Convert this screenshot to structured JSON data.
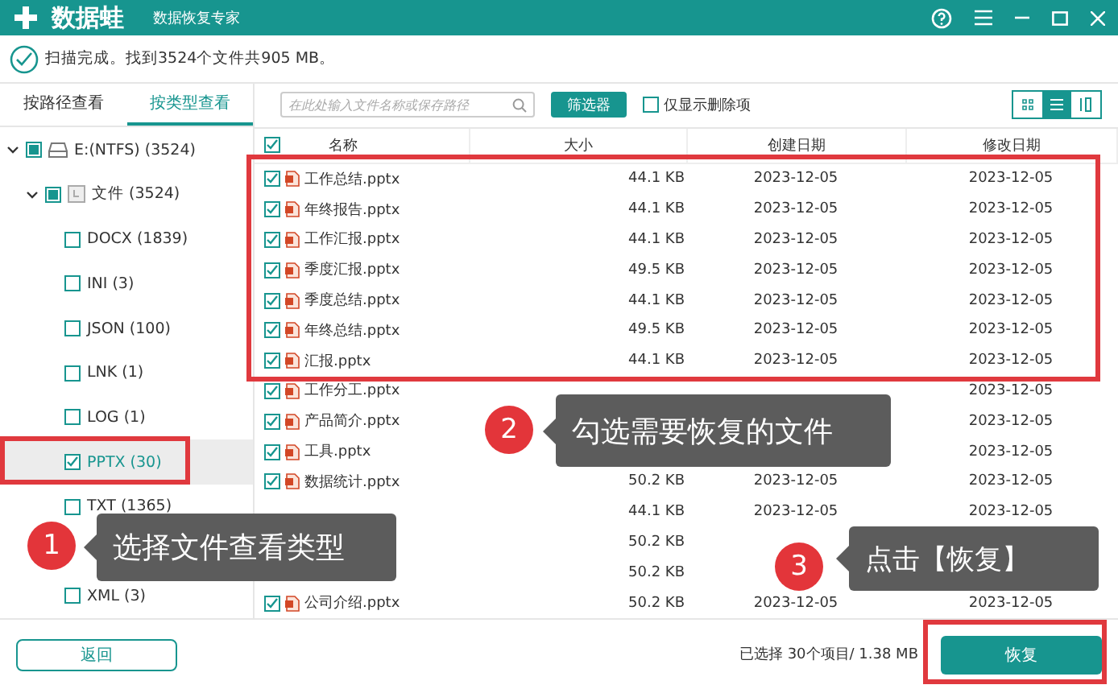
{
  "window": {
    "app_name": "数据蛙",
    "subtitle": "数据恢复专家"
  },
  "status": "扫描完成。找到3524个文件共905 MB。",
  "view_tabs": [
    {
      "label": "按路径查看",
      "selected": false
    },
    {
      "label": "按类型查看",
      "selected": true
    }
  ],
  "search": {
    "placeholder": "在此处输入文件名称或保存路径"
  },
  "filter_button": "筛选器",
  "deleted_only": {
    "label": "仅显示删除项",
    "checked": false
  },
  "view_modes": [
    {
      "kind": "grid",
      "selected": false
    },
    {
      "kind": "list",
      "selected": true
    },
    {
      "kind": "detail",
      "selected": false
    }
  ],
  "tree": [
    {
      "label": "E:(NTFS) (3524)",
      "kind": "drive",
      "checked": true,
      "partial": true,
      "expanded": true,
      "selected": false,
      "children": [
        {
          "label": "文件 (3524)",
          "kind": "folder",
          "checked": true,
          "partial": true,
          "expanded": true,
          "selected": false,
          "children": [
            {
              "label": "DOCX (1839)",
              "checked": false,
              "selected": false
            },
            {
              "label": "INI (3)",
              "checked": false,
              "selected": false
            },
            {
              "label": "JSON (100)",
              "checked": false,
              "selected": false
            },
            {
              "label": "LNK (1)",
              "checked": false,
              "selected": false
            },
            {
              "label": "LOG (1)",
              "checked": false,
              "selected": false
            },
            {
              "label": "PPTX (30)",
              "checked": true,
              "selected": true
            },
            {
              "label": "TXT (1365)",
              "checked": false,
              "selected": false
            },
            {
              "kind": "covered"
            },
            {
              "label": "XML (3)",
              "checked": false,
              "selected": false
            }
          ]
        }
      ]
    }
  ],
  "table": {
    "all_checked": true,
    "columns": [
      "名称",
      "大小",
      "创建日期",
      "修改日期"
    ],
    "rows": [
      {
        "checked": true,
        "name": "工作总结.pptx",
        "size": "44.1 KB",
        "created": "2023-12-05",
        "modified": "2023-12-05"
      },
      {
        "checked": true,
        "name": "年终报告.pptx",
        "size": "44.1 KB",
        "created": "2023-12-05",
        "modified": "2023-12-05"
      },
      {
        "checked": true,
        "name": "工作汇报.pptx",
        "size": "44.1 KB",
        "created": "2023-12-05",
        "modified": "2023-12-05"
      },
      {
        "checked": true,
        "name": "季度汇报.pptx",
        "size": "49.5 KB",
        "created": "2023-12-05",
        "modified": "2023-12-05"
      },
      {
        "checked": true,
        "name": "季度总结.pptx",
        "size": "44.1 KB",
        "created": "2023-12-05",
        "modified": "2023-12-05"
      },
      {
        "checked": true,
        "name": "年终总结.pptx",
        "size": "49.5 KB",
        "created": "2023-12-05",
        "modified": "2023-12-05"
      },
      {
        "checked": true,
        "name": "汇报.pptx",
        "size": "44.1 KB",
        "created": "2023-12-05",
        "modified": "2023-12-05"
      },
      {
        "checked": true,
        "name": "工作分工.pptx",
        "modified": "2023-12-05"
      },
      {
        "checked": true,
        "name": "产品简介.pptx",
        "modified": "2023-12-05"
      },
      {
        "checked": true,
        "name": "工具.pptx",
        "modified": "2023-12-05"
      },
      {
        "checked": true,
        "name": "数据统计.pptx",
        "size": "50.2 KB",
        "created": "2023-12-05",
        "modified": "2023-12-05"
      },
      {
        "size": "44.1 KB",
        "created": "2023-12-05",
        "modified": "2023-12-05"
      },
      {
        "size": "50.2 KB"
      },
      {
        "size": "50.2 KB"
      },
      {
        "checked": true,
        "name": "公司介绍.pptx",
        "size": "50.2 KB",
        "created": "2023-12-05",
        "modified": "2023-12-05"
      }
    ]
  },
  "back_button": "返回",
  "selection_summary": "已选择 30个项目/ 1.38 MB",
  "recover_button": "恢复",
  "callouts": [
    {
      "number": "1",
      "text": "选择文件查看类型"
    },
    {
      "number": "2",
      "text": "勾选需要恢复的文件"
    },
    {
      "number": "3",
      "text": "点击【恢复】"
    }
  ]
}
